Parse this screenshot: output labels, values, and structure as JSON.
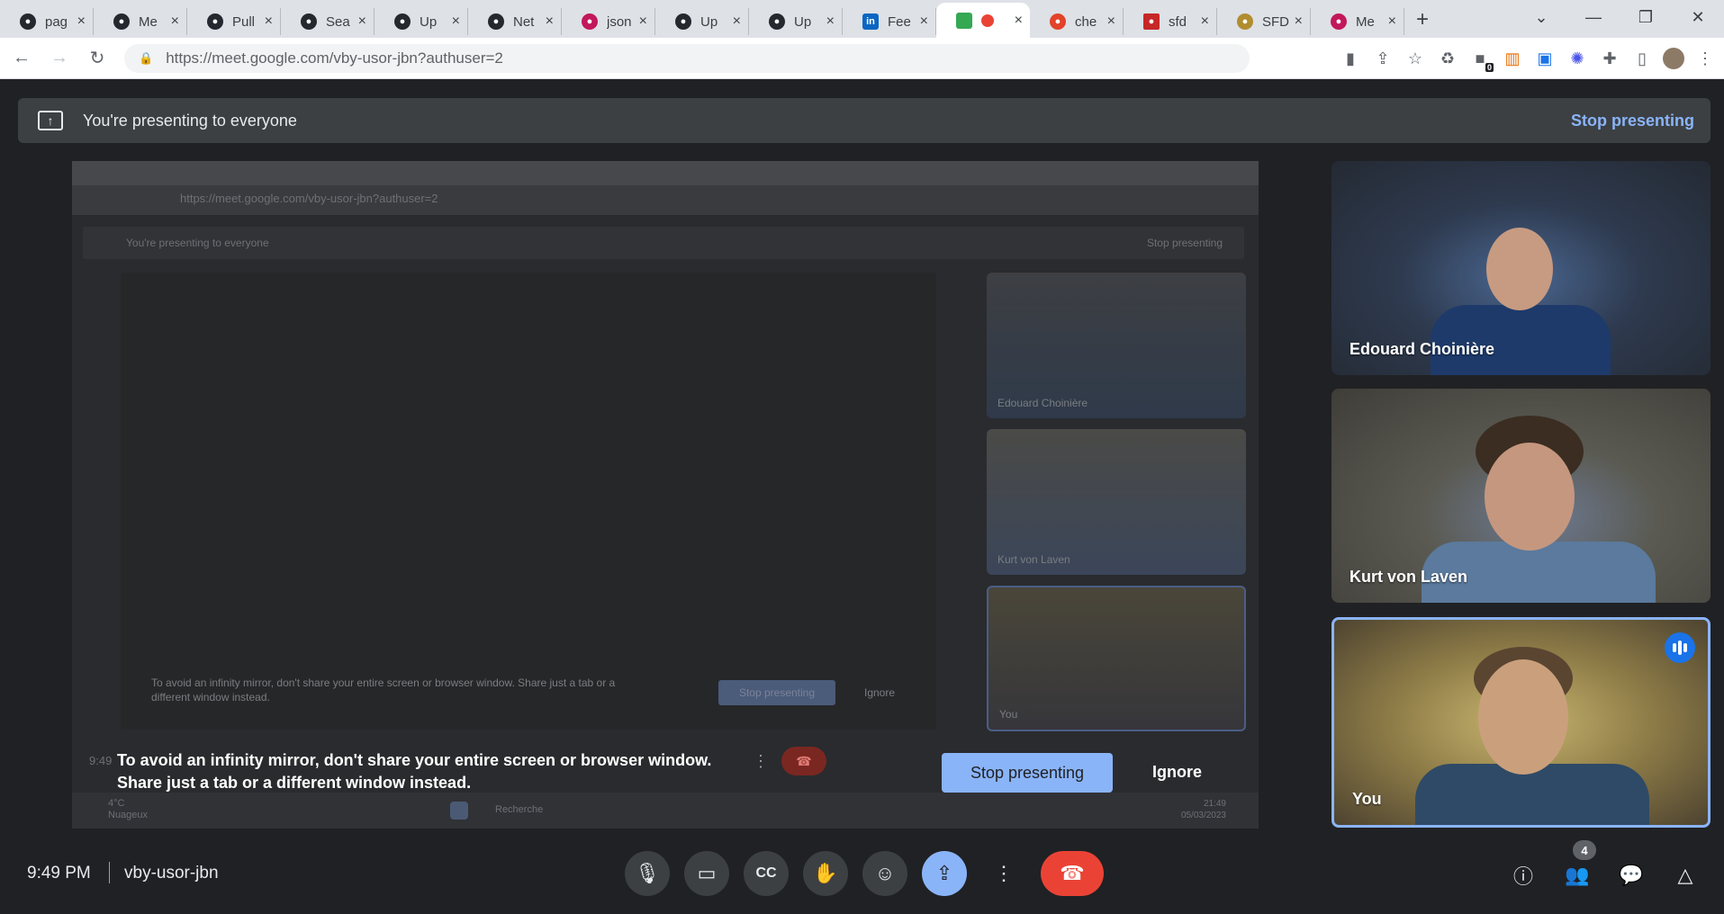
{
  "browser": {
    "tabs": [
      {
        "label": "pag",
        "icon": "github-icon"
      },
      {
        "label": "Me",
        "icon": "github-icon"
      },
      {
        "label": "Pull",
        "icon": "github-icon"
      },
      {
        "label": "Sea",
        "icon": "github-icon"
      },
      {
        "label": "Up",
        "icon": "github-icon"
      },
      {
        "label": "Net",
        "icon": "github-icon"
      },
      {
        "label": "json",
        "icon": "doc-icon"
      },
      {
        "label": "Up",
        "icon": "github-icon"
      },
      {
        "label": "Up",
        "icon": "github-icon"
      },
      {
        "label": "Fee",
        "icon": "linkedin-icon"
      },
      {
        "label": "",
        "icon": "meet-icon"
      },
      {
        "label": "che",
        "icon": "gitlab-icon"
      },
      {
        "label": "sfd",
        "icon": "doc-icon"
      },
      {
        "label": "SFD",
        "icon": "doc-icon"
      },
      {
        "label": "Me",
        "icon": "doc-icon"
      }
    ],
    "url": "https://meet.google.com/vby-usor-jbn?authuser=2",
    "extension_badge": "0"
  },
  "banner": {
    "text": "You're presenting to everyone",
    "stop_label": "Stop presenting"
  },
  "share_preview": {
    "url": "https://meet.google.com/vby-usor-jbn?authuser=2",
    "banner_text": "You're presenting to everyone",
    "banner_stop": "Stop presenting",
    "tiles": [
      "Edouard Choinière",
      "Kurt von Laven",
      "You"
    ],
    "msg": "To avoid an infinity mirror, don't share your entire screen or browser window. Share just a tab or a different window instead.",
    "stop_label": "Stop presenting",
    "ignore_label": "Ignore",
    "weather_temp": "4°C",
    "weather_desc": "Nuageux",
    "search_label": "Recherche",
    "clock_time": "21:49",
    "clock_date": "05/03/2023"
  },
  "notice": {
    "time": "9:49",
    "message": "To avoid an infinity mirror, don't share your entire screen or browser window. Share just a tab or a different window instead.",
    "stop_label": "Stop presenting",
    "ignore_label": "Ignore"
  },
  "participants": [
    {
      "name": "Edouard Choinière",
      "speaking": false
    },
    {
      "name": "Kurt von Laven",
      "speaking": false
    },
    {
      "name": "You",
      "speaking": true
    }
  ],
  "bottom": {
    "time": "9:49 PM",
    "meeting_code": "vby-usor-jbn",
    "people_count": "4"
  },
  "colors": {
    "accent": "#8ab4f8",
    "end_call": "#ea4335",
    "background": "#202124"
  }
}
